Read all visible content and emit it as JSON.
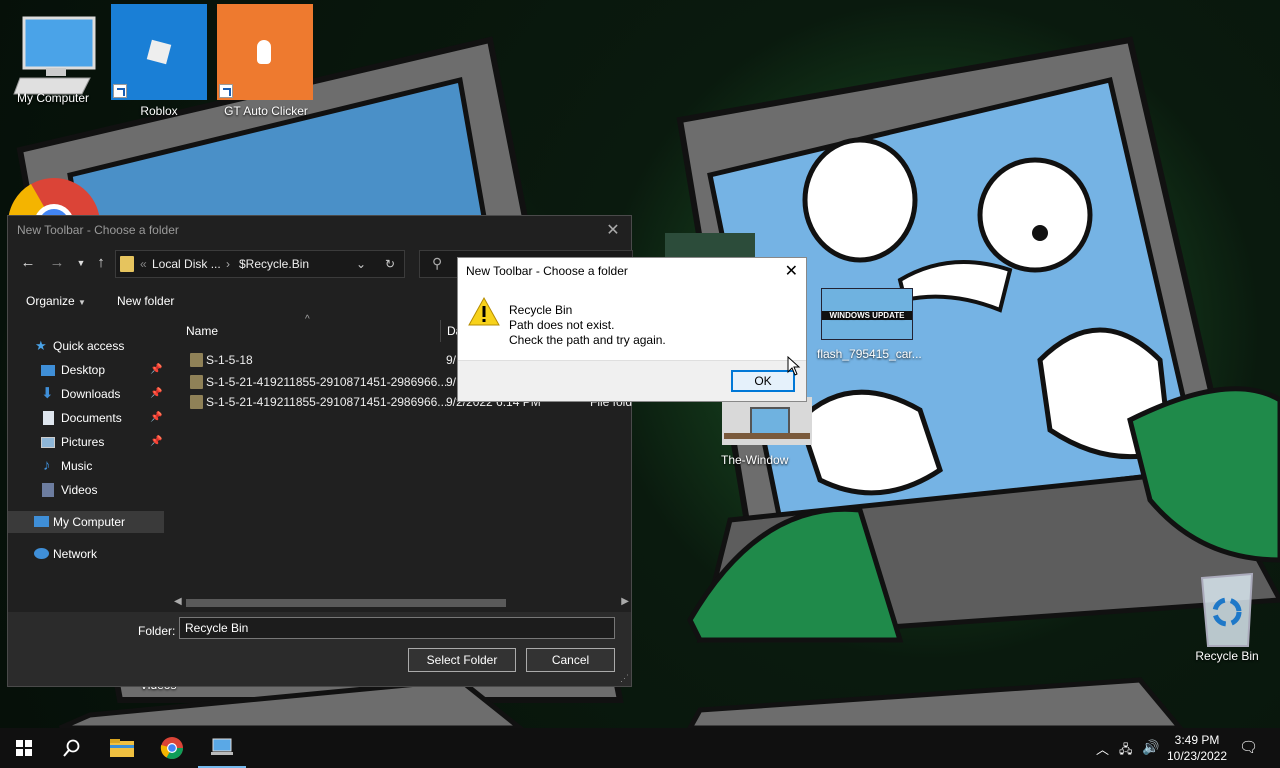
{
  "desktop": {
    "icons": [
      {
        "label": "My Computer"
      },
      {
        "label": "Roblox"
      },
      {
        "label": "GT Auto Clicker"
      },
      {
        "label": "flash_795415_car..."
      },
      {
        "label": "The-Window"
      },
      {
        "label": "Recycle Bin"
      },
      {
        "label": "Videos"
      }
    ],
    "thumbnail_text": "WINDOWS UPDATE"
  },
  "file_dialog": {
    "title": "New Toolbar - Choose a folder",
    "address": {
      "segment1": "Local Disk ...",
      "segment2": "$Recycle.Bin",
      "separator": "›",
      "overflow": "«"
    },
    "commands": {
      "organize": "Organize",
      "new_folder": "New folder"
    },
    "nav": [
      {
        "label": "Quick access",
        "icon": "star-icon",
        "pinned": false
      },
      {
        "label": "Desktop",
        "icon": "desktop-icon",
        "pinned": true
      },
      {
        "label": "Downloads",
        "icon": "download-icon",
        "pinned": true
      },
      {
        "label": "Documents",
        "icon": "documents-icon",
        "pinned": true
      },
      {
        "label": "Pictures",
        "icon": "pictures-icon",
        "pinned": true
      },
      {
        "label": "Music",
        "icon": "music-icon",
        "pinned": false
      },
      {
        "label": "Videos",
        "icon": "videos-icon",
        "pinned": false
      },
      {
        "label": "My Computer",
        "icon": "computer-icon",
        "pinned": false
      },
      {
        "label": "Network",
        "icon": "network-icon",
        "pinned": false
      }
    ],
    "columns": {
      "name": "Name",
      "date": "Da"
    },
    "files": [
      {
        "name": "S-1-5-18",
        "date": "9/",
        "type": ""
      },
      {
        "name": "S-1-5-21-419211855-2910871451-2986966...",
        "date": "9/",
        "type": ""
      },
      {
        "name": "S-1-5-21-419211855-2910871451-2986966...",
        "date": "9/2/2022 6:14 PM",
        "type": "File fold"
      }
    ],
    "folder_label": "Folder:",
    "folder_value": "Recycle Bin",
    "select_button": "Select Folder",
    "cancel_button": "Cancel"
  },
  "message_box": {
    "title": "New Toolbar - Choose a folder",
    "line1": "Recycle Bin",
    "line2": "Path does not exist.",
    "line3": "Check the path and try again.",
    "ok": "OK"
  },
  "taskbar": {
    "time": "3:49 PM",
    "date": "10/23/2022"
  },
  "colors": {
    "accent": "#0078d7",
    "dialog_bg": "#202020",
    "taskbar": "#101010"
  }
}
